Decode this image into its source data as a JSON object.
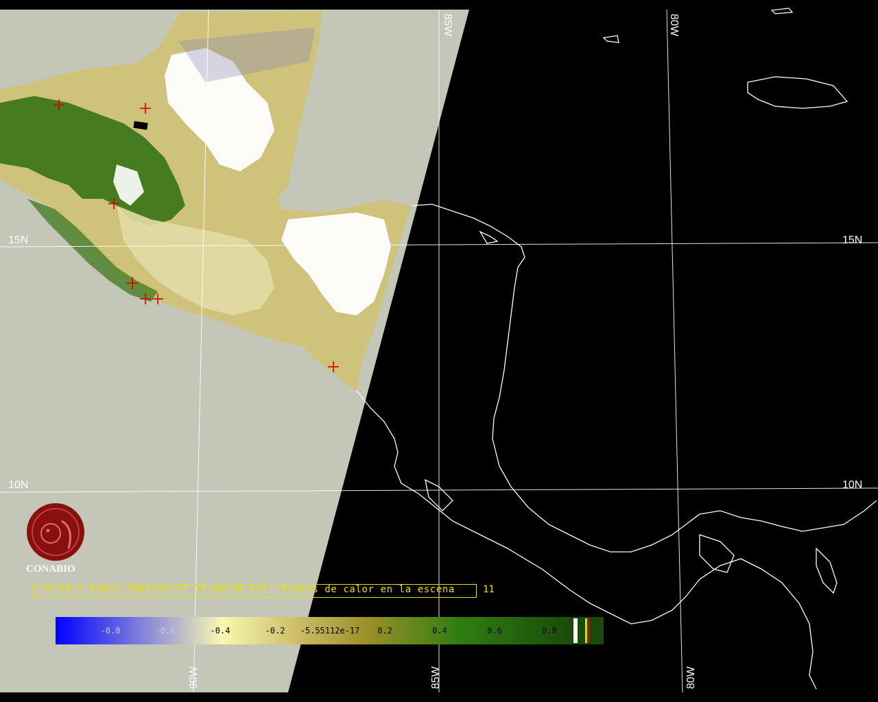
{
  "map": {
    "latitude_labels": [
      "15N",
      "10N"
    ],
    "longitude_labels_top": [
      "85W",
      "80W"
    ],
    "longitude_labels_bottom": [
      "90W",
      "85W",
      "80W"
    ],
    "colors": {
      "no_data": "#c4c6b8",
      "night": "#000000",
      "coastline": "#ffffff",
      "graticule": "#ffffff",
      "hotspot": "#d40000",
      "vegetation_dark": "#2f6e12",
      "vegetation_light": "#d6cf8e",
      "cloud": "#ffffff"
    },
    "hotspot_count_shown": 11
  },
  "logo": {
    "text": "CONABIO",
    "icon": "conabio-logo-icon"
  },
  "caption": {
    "text": "terra-1 modis 2009/01/27 17:00:09 EVI, Puntos de calor en la escena",
    "count": "11"
  },
  "colorbar": {
    "title": "",
    "ticks": [
      "-0.8",
      "-0.6",
      "-0.4",
      "-0.2",
      "-5.55112e-17",
      "0.2",
      "0.4",
      "0.6",
      "0.8"
    ],
    "range": [
      -1.0,
      1.0
    ],
    "gradient": [
      "#0000ff",
      "#8c8cd8",
      "#f8f8b0",
      "#c8b860",
      "#9c9028",
      "#2f7d10",
      "#1a4a0a"
    ],
    "legend_swatches": [
      "#ffffff",
      "#e8d800",
      "#d40000"
    ]
  }
}
